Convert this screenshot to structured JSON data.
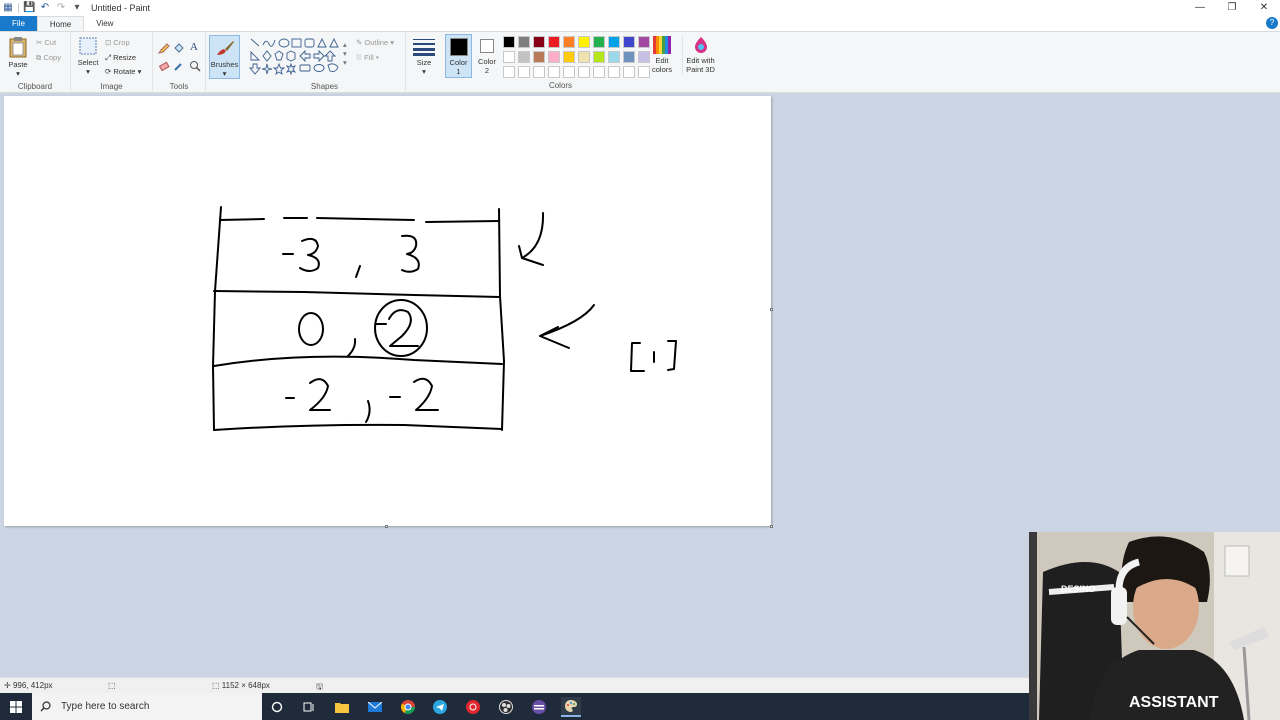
{
  "window": {
    "title": "Untitled - Paint",
    "minimize": "—",
    "maximize": "❐",
    "close": "✕"
  },
  "tabs": [
    {
      "label": "File"
    },
    {
      "label": "Home"
    },
    {
      "label": "View"
    }
  ],
  "help": "?",
  "clipboard": {
    "paste": "Paste",
    "cut": "Cut",
    "copy": "Copy",
    "title": "Clipboard"
  },
  "image": {
    "select": "Select",
    "crop": "Crop",
    "resize": "Resize",
    "rotate": "Rotate",
    "title": "Image"
  },
  "tools": {
    "title": "Tools",
    "text": "A"
  },
  "brushes": {
    "label": "Brushes"
  },
  "shapes": {
    "outline": "Outline",
    "fill": "Fill",
    "title": "Shapes"
  },
  "size": {
    "label": "Size"
  },
  "colors": {
    "color1_label": "Color",
    "color1_num": "1",
    "color2_label": "Color",
    "color2_num": "2",
    "edit_colors": "Edit colors",
    "edit_paint3d": "Edit with Paint 3D",
    "title": "Colors",
    "color1": "#000000",
    "color2": "#ffffff",
    "palette": [
      "#000000",
      "#7f7f7f",
      "#880015",
      "#ed1c24",
      "#ff7f27",
      "#fff200",
      "#22b14c",
      "#00a2e8",
      "#3f48cc",
      "#a349a4",
      "#ffffff",
      "#c3c3c3",
      "#b97a57",
      "#ffaec9",
      "#ffc90e",
      "#efe4b0",
      "#b5e61d",
      "#99d9ea",
      "#7092be",
      "#c8bfe7",
      "#ffffff",
      "#ffffff",
      "#ffffff",
      "#ffffff",
      "#ffffff",
      "#ffffff",
      "#ffffff",
      "#ffffff",
      "#ffffff",
      "#ffffff"
    ]
  },
  "status": {
    "cursor": "996, 412px",
    "canvas_size": "1152 × 648px"
  },
  "taskbar": {
    "search_placeholder": "Type here to search"
  }
}
